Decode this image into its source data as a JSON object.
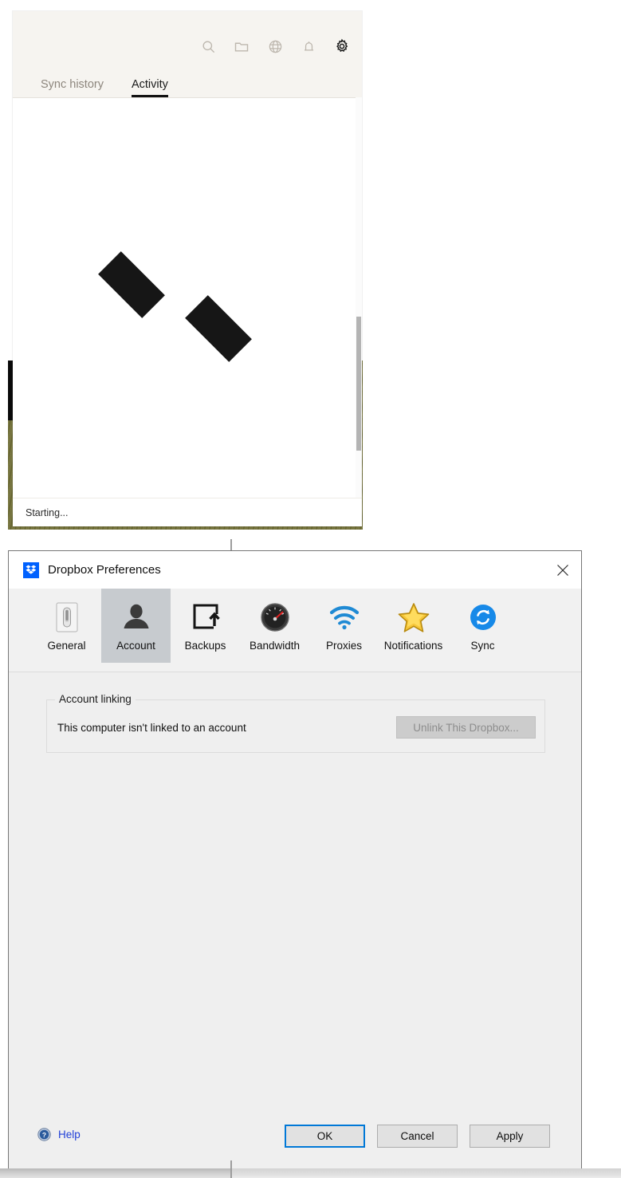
{
  "activity_panel": {
    "header_icons": [
      {
        "name": "search-icon",
        "label": "Search"
      },
      {
        "name": "folder-icon",
        "label": "Open folder"
      },
      {
        "name": "globe-icon",
        "label": "Dropbox website"
      },
      {
        "name": "bell-icon",
        "label": "Notifications"
      },
      {
        "name": "gear-icon",
        "label": "Settings"
      }
    ],
    "tabs": [
      {
        "label": "Sync history",
        "active": false
      },
      {
        "label": "Activity",
        "active": true
      }
    ],
    "status_text": "Starting...",
    "scrollbar_present": true
  },
  "dialog": {
    "title": "Dropbox Preferences",
    "logo_name": "dropbox-logo",
    "close_label": "Close",
    "tabs": [
      {
        "label": "General",
        "icon": "light-switch-icon",
        "selected": false
      },
      {
        "label": "Account",
        "icon": "person-icon",
        "selected": true
      },
      {
        "label": "Backups",
        "icon": "backup-upload-icon",
        "selected": false
      },
      {
        "label": "Bandwidth",
        "icon": "speedometer-icon",
        "selected": false
      },
      {
        "label": "Proxies",
        "icon": "wifi-icon",
        "selected": false
      },
      {
        "label": "Notifications",
        "icon": "star-icon",
        "selected": false
      },
      {
        "label": "Sync",
        "icon": "sync-circle-icon",
        "selected": false
      }
    ],
    "account_linking": {
      "group_title": "Account linking",
      "status": "This computer isn't linked to an account",
      "unlink_button": "Unlink This Dropbox..."
    },
    "footer": {
      "help_label": "Help",
      "buttons": [
        {
          "label": "OK",
          "default": true
        },
        {
          "label": "Cancel",
          "default": false
        },
        {
          "label": "Apply",
          "default": false
        }
      ]
    }
  },
  "colors": {
    "dropbox_blue": "#0061fe",
    "focus_blue": "#0078d7",
    "link_blue": "#1f3fd8",
    "selected_tab_bg": "#c7cbcf",
    "dialog_bg": "#efefef"
  }
}
